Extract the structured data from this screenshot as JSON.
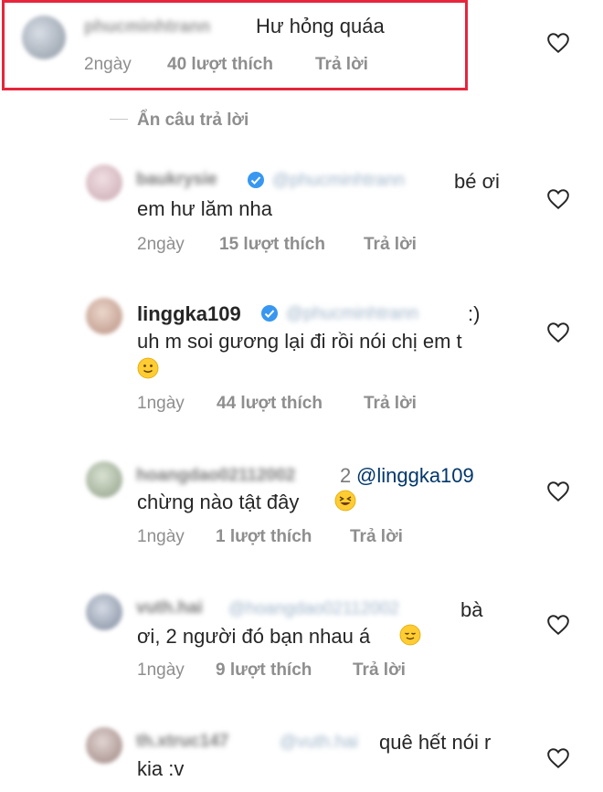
{
  "comments": [
    {
      "username_blurred": "phucminhtrann",
      "text": "Hư hỏng quáa",
      "time": "2ngày",
      "likes": "40 lượt thích",
      "reply": "Trả lời"
    },
    {
      "username_blurred": "baukrysie",
      "mention_blurred": "@phucminhtrann",
      "text_line1": "bé ơi",
      "text_line2": "em hư lăm nha",
      "time": "2ngày",
      "likes": "15 lượt thích",
      "reply": "Trả lời"
    },
    {
      "username": "linggka109",
      "mention_blurred": "@phucminhtrann",
      "text_tail": ":)",
      "text_line2": "uh m soi gương lại đi rồi nói chị em t",
      "time": "1ngày",
      "likes": "44 lượt thích",
      "reply": "Trả lời"
    },
    {
      "username_blurred": "hoangdao02112002",
      "mention_visible_prefix": "2",
      "mention": "@linggka109",
      "text_line2": "chừng nào tật đây",
      "time": "1ngày",
      "likes": "1 lượt thích",
      "reply": "Trả lời"
    },
    {
      "username_blurred": "vuth.hai",
      "mention_blurred": "@hoangdao02112002",
      "text_tail": "bà",
      "text_line2": "ơi, 2 người đó bạn nhau á",
      "time": "1ngày",
      "likes": "9 lượt thích",
      "reply": "Trả lời"
    },
    {
      "username_blurred": "th.xtruc147",
      "mention_blurred": "@vuth.hai",
      "text_tail": "quê hết nói r",
      "text_line2": "kia :v"
    }
  ],
  "hide_replies": "Ẩn câu trả lời",
  "icons": {
    "like": "heart-outline-icon",
    "verified": "verified-badge-icon",
    "emoji": [
      "slightly-smiling-face-emoji",
      "grinning-squinting-face-emoji",
      "relieved-face-emoji"
    ]
  },
  "colors": {
    "highlight": "#e5263c",
    "verified": "#3897f0",
    "meta": "#8e8e8e",
    "mention": "#00376b"
  }
}
